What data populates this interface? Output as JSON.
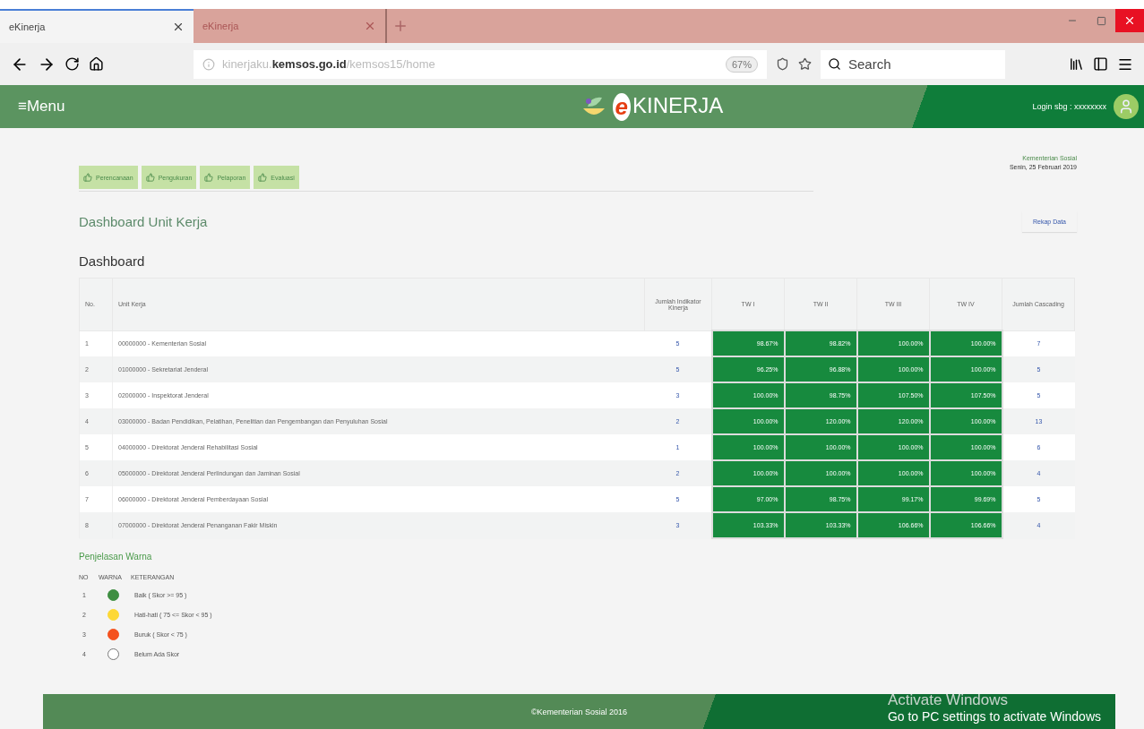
{
  "browser": {
    "tabs": [
      {
        "label": "eKinerja",
        "selected": true
      },
      {
        "label": "eKinerja",
        "selected": false
      }
    ],
    "url": "kinerjaku.**kemsos.go.id**/kemsos15/home",
    "zoom": "67%",
    "search": {
      "placeholder": "Search"
    }
  },
  "header": {
    "menu": "≡Menu",
    "logo_prefix": "e",
    "logo": "KINERJA",
    "login": "Login sbg : xxxxxxxx"
  },
  "nav": [
    "Perencanaan",
    "Pengukuran",
    "Pelaporan",
    "Evaluasi"
  ],
  "org": "Kementerian Sosial",
  "date": "Senin, 25 Februari 2019",
  "section_title": "Dashboard Unit Kerja",
  "rekap_button": "Rekap Data",
  "dashboard_title": "Dashboard",
  "table": {
    "columns": [
      "No.",
      "Unit Kerja",
      "Jumlah Indikator Kinerja",
      "TW I",
      "TW II",
      "TW III",
      "TW IV",
      "Jumlah Cascading"
    ],
    "rows": [
      {
        "no": "1",
        "unit": "00000000 - Kementerian Sosial",
        "indikator": "5",
        "tw": [
          "98.67%",
          "98.82%",
          "100.00%",
          "100.00%"
        ],
        "cascading": "7"
      },
      {
        "no": "2",
        "unit": "01000000 - Sekretariat Jenderal",
        "indikator": "5",
        "tw": [
          "96.25%",
          "96.88%",
          "100.00%",
          "100.00%"
        ],
        "cascading": "5"
      },
      {
        "no": "3",
        "unit": "02000000 - Inspektorat Jenderal",
        "indikator": "3",
        "tw": [
          "100.00%",
          "98.75%",
          "107.50%",
          "107.50%"
        ],
        "cascading": "5"
      },
      {
        "no": "4",
        "unit": "03000000 - Badan Pendidikan, Pelatihan, Penelitian dan Pengembangan dan Penyuluhan Sosial",
        "indikator": "2",
        "tw": [
          "100.00%",
          "120.00%",
          "120.00%",
          "100.00%"
        ],
        "cascading": "13"
      },
      {
        "no": "5",
        "unit": "04000000 - Direktorat Jenderal Rehabilitasi Sosial",
        "indikator": "1",
        "tw": [
          "100.00%",
          "100.00%",
          "100.00%",
          "100.00%"
        ],
        "cascading": "6"
      },
      {
        "no": "6",
        "unit": "05000000 - Direktorat Jenderal Perlindungan dan Jaminan Sosial",
        "indikator": "2",
        "tw": [
          "100.00%",
          "100.00%",
          "100.00%",
          "100.00%"
        ],
        "cascading": "4"
      },
      {
        "no": "7",
        "unit": "06000000 - Direktorat Jenderal Pemberdayaan Sosial",
        "indikator": "5",
        "tw": [
          "97.00%",
          "98.75%",
          "99.17%",
          "99.69%"
        ],
        "cascading": "5"
      },
      {
        "no": "8",
        "unit": "07000000 - Direktorat Jenderal Penanganan Fakir Miskin",
        "indikator": "3",
        "tw": [
          "103.33%",
          "103.33%",
          "106.66%",
          "106.66%"
        ],
        "cascading": "4"
      }
    ]
  },
  "legend": {
    "title": "Penjelasan Warna",
    "columns": [
      "NO",
      "WARNA",
      "KETERANGAN"
    ],
    "items": [
      {
        "no": "1",
        "color": "#3e8e41",
        "label": "Baik ( Skor >= 95 )"
      },
      {
        "no": "2",
        "color": "#fdd835",
        "label": "Hati-hati ( 75 <= Skor < 95 )"
      },
      {
        "no": "3",
        "color": "#f4511e",
        "label": "Buruk ( Skor < 75 )"
      },
      {
        "no": "4",
        "color": "#ffffff",
        "label": "Belum Ada Skor"
      }
    ]
  },
  "footer": "©Kementerian Sosial 2016",
  "activation": {
    "title": "Activate Windows",
    "text": "Go to PC settings to activate Windows"
  }
}
